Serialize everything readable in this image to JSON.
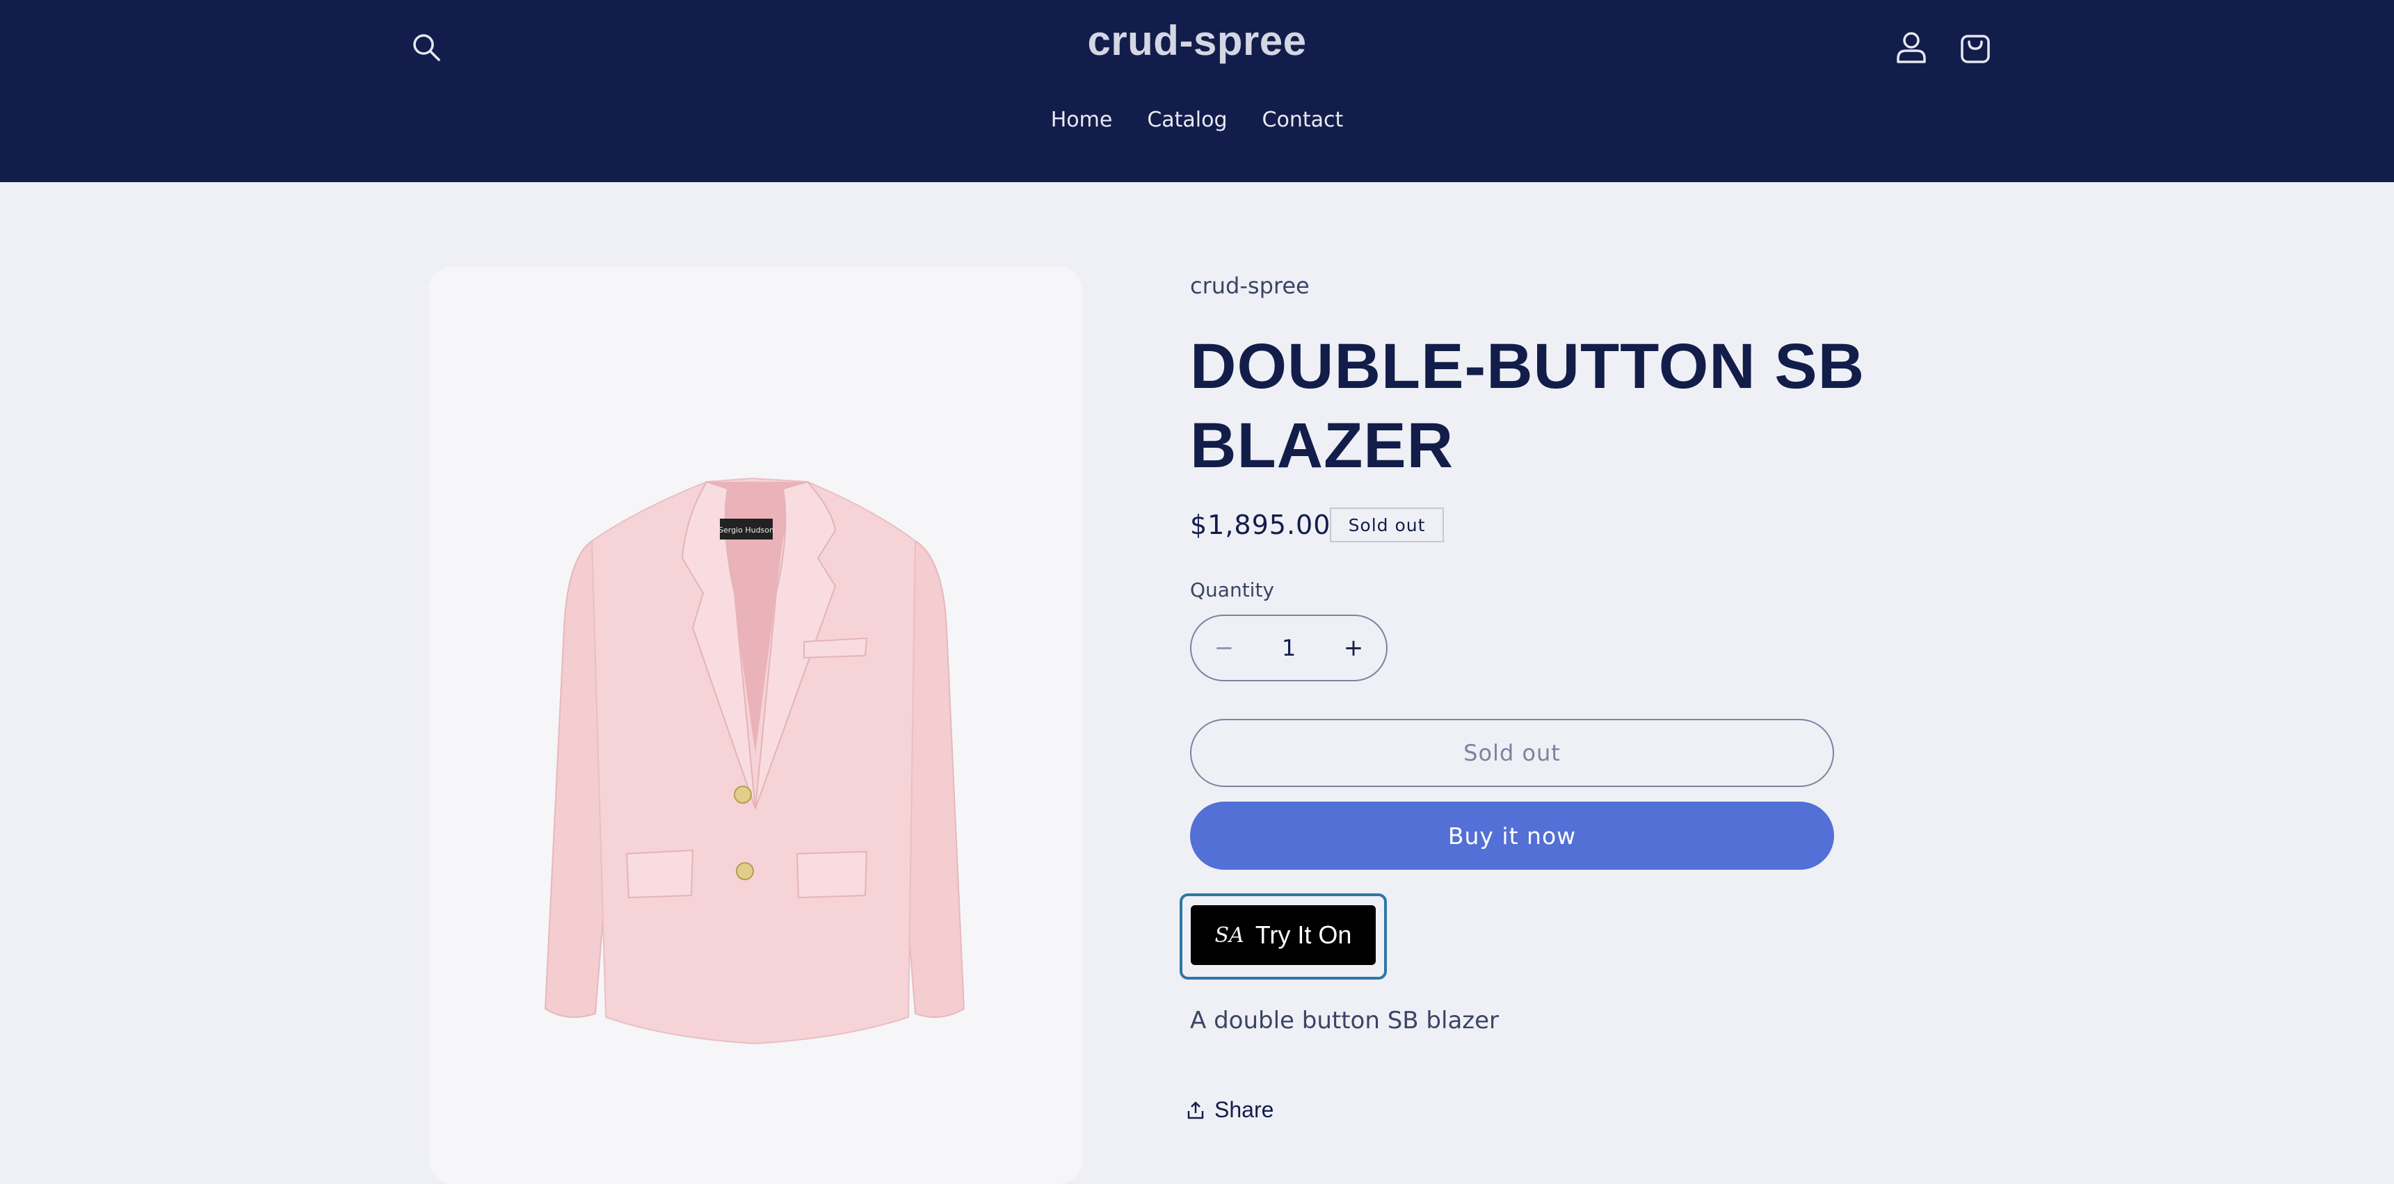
{
  "header": {
    "logo": "crud-spree",
    "nav": [
      "Home",
      "Catalog",
      "Contact"
    ],
    "search_icon": "search-icon",
    "account_icon": "account-icon",
    "cart_icon": "cart-icon",
    "background": "#121d4b"
  },
  "product": {
    "vendor": "crud-spree",
    "title": "DOUBLE-BUTTON SB BLAZER",
    "price": "$1,895.00",
    "badge": "Sold out",
    "quantity_label": "Quantity",
    "quantity_value": "1",
    "minus_symbol": "−",
    "plus_symbol": "+",
    "sold_out_button": "Sold out",
    "buy_button": "Buy it now",
    "try_on_logo": "SA",
    "try_on_button": "Try It On",
    "description": "A double button SB blazer",
    "share_label": "Share",
    "image_label": "Sergio Hudson",
    "accent": "#5270d5"
  }
}
